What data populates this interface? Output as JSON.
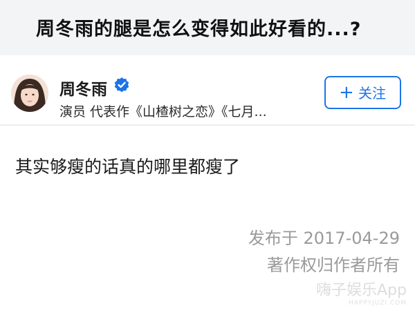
{
  "question": {
    "title": "周冬雨的腿是怎么变得如此好看的...?"
  },
  "author": {
    "name": "周冬雨",
    "verified_icon": "verified-badge-icon",
    "bio": "演员 代表作《山楂树之恋》《七月...",
    "follow_plus": "+",
    "follow_label": "关注"
  },
  "answer": {
    "text": "其实够瘦的话真的哪里都瘦了",
    "publish_date": "发布于 2017-04-29",
    "copyright": "著作权归作者所有"
  },
  "watermark": {
    "main": "嗨子娱乐App",
    "sub": "HAPPYJUZI.COM"
  },
  "colors": {
    "accent": "#1b74e8",
    "header_bg": "#f3f4f6",
    "meta_text": "#9a9a9a"
  }
}
